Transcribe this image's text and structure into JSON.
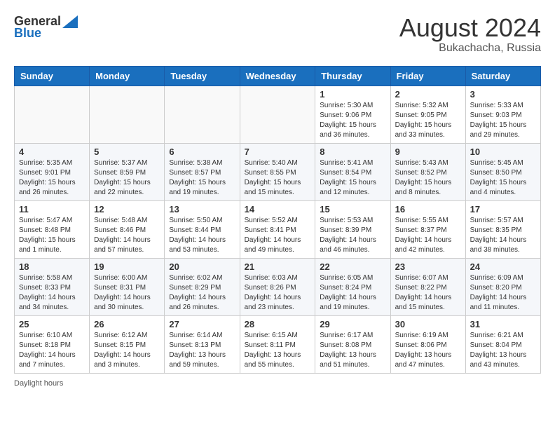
{
  "header": {
    "logo_general": "General",
    "logo_blue": "Blue",
    "month_year": "August 2024",
    "location": "Bukachacha, Russia"
  },
  "days_of_week": [
    "Sunday",
    "Monday",
    "Tuesday",
    "Wednesday",
    "Thursday",
    "Friday",
    "Saturday"
  ],
  "weeks": [
    [
      {
        "day": "",
        "info": ""
      },
      {
        "day": "",
        "info": ""
      },
      {
        "day": "",
        "info": ""
      },
      {
        "day": "",
        "info": ""
      },
      {
        "day": "1",
        "info": "Sunrise: 5:30 AM\nSunset: 9:06 PM\nDaylight: 15 hours\nand 36 minutes."
      },
      {
        "day": "2",
        "info": "Sunrise: 5:32 AM\nSunset: 9:05 PM\nDaylight: 15 hours\nand 33 minutes."
      },
      {
        "day": "3",
        "info": "Sunrise: 5:33 AM\nSunset: 9:03 PM\nDaylight: 15 hours\nand 29 minutes."
      }
    ],
    [
      {
        "day": "4",
        "info": "Sunrise: 5:35 AM\nSunset: 9:01 PM\nDaylight: 15 hours\nand 26 minutes."
      },
      {
        "day": "5",
        "info": "Sunrise: 5:37 AM\nSunset: 8:59 PM\nDaylight: 15 hours\nand 22 minutes."
      },
      {
        "day": "6",
        "info": "Sunrise: 5:38 AM\nSunset: 8:57 PM\nDaylight: 15 hours\nand 19 minutes."
      },
      {
        "day": "7",
        "info": "Sunrise: 5:40 AM\nSunset: 8:55 PM\nDaylight: 15 hours\nand 15 minutes."
      },
      {
        "day": "8",
        "info": "Sunrise: 5:41 AM\nSunset: 8:54 PM\nDaylight: 15 hours\nand 12 minutes."
      },
      {
        "day": "9",
        "info": "Sunrise: 5:43 AM\nSunset: 8:52 PM\nDaylight: 15 hours\nand 8 minutes."
      },
      {
        "day": "10",
        "info": "Sunrise: 5:45 AM\nSunset: 8:50 PM\nDaylight: 15 hours\nand 4 minutes."
      }
    ],
    [
      {
        "day": "11",
        "info": "Sunrise: 5:47 AM\nSunset: 8:48 PM\nDaylight: 15 hours\nand 1 minute."
      },
      {
        "day": "12",
        "info": "Sunrise: 5:48 AM\nSunset: 8:46 PM\nDaylight: 14 hours\nand 57 minutes."
      },
      {
        "day": "13",
        "info": "Sunrise: 5:50 AM\nSunset: 8:44 PM\nDaylight: 14 hours\nand 53 minutes."
      },
      {
        "day": "14",
        "info": "Sunrise: 5:52 AM\nSunset: 8:41 PM\nDaylight: 14 hours\nand 49 minutes."
      },
      {
        "day": "15",
        "info": "Sunrise: 5:53 AM\nSunset: 8:39 PM\nDaylight: 14 hours\nand 46 minutes."
      },
      {
        "day": "16",
        "info": "Sunrise: 5:55 AM\nSunset: 8:37 PM\nDaylight: 14 hours\nand 42 minutes."
      },
      {
        "day": "17",
        "info": "Sunrise: 5:57 AM\nSunset: 8:35 PM\nDaylight: 14 hours\nand 38 minutes."
      }
    ],
    [
      {
        "day": "18",
        "info": "Sunrise: 5:58 AM\nSunset: 8:33 PM\nDaylight: 14 hours\nand 34 minutes."
      },
      {
        "day": "19",
        "info": "Sunrise: 6:00 AM\nSunset: 8:31 PM\nDaylight: 14 hours\nand 30 minutes."
      },
      {
        "day": "20",
        "info": "Sunrise: 6:02 AM\nSunset: 8:29 PM\nDaylight: 14 hours\nand 26 minutes."
      },
      {
        "day": "21",
        "info": "Sunrise: 6:03 AM\nSunset: 8:26 PM\nDaylight: 14 hours\nand 23 minutes."
      },
      {
        "day": "22",
        "info": "Sunrise: 6:05 AM\nSunset: 8:24 PM\nDaylight: 14 hours\nand 19 minutes."
      },
      {
        "day": "23",
        "info": "Sunrise: 6:07 AM\nSunset: 8:22 PM\nDaylight: 14 hours\nand 15 minutes."
      },
      {
        "day": "24",
        "info": "Sunrise: 6:09 AM\nSunset: 8:20 PM\nDaylight: 14 hours\nand 11 minutes."
      }
    ],
    [
      {
        "day": "25",
        "info": "Sunrise: 6:10 AM\nSunset: 8:18 PM\nDaylight: 14 hours\nand 7 minutes."
      },
      {
        "day": "26",
        "info": "Sunrise: 6:12 AM\nSunset: 8:15 PM\nDaylight: 14 hours\nand 3 minutes."
      },
      {
        "day": "27",
        "info": "Sunrise: 6:14 AM\nSunset: 8:13 PM\nDaylight: 13 hours\nand 59 minutes."
      },
      {
        "day": "28",
        "info": "Sunrise: 6:15 AM\nSunset: 8:11 PM\nDaylight: 13 hours\nand 55 minutes."
      },
      {
        "day": "29",
        "info": "Sunrise: 6:17 AM\nSunset: 8:08 PM\nDaylight: 13 hours\nand 51 minutes."
      },
      {
        "day": "30",
        "info": "Sunrise: 6:19 AM\nSunset: 8:06 PM\nDaylight: 13 hours\nand 47 minutes."
      },
      {
        "day": "31",
        "info": "Sunrise: 6:21 AM\nSunset: 8:04 PM\nDaylight: 13 hours\nand 43 minutes."
      }
    ]
  ],
  "footer": {
    "daylight_label": "Daylight hours"
  }
}
